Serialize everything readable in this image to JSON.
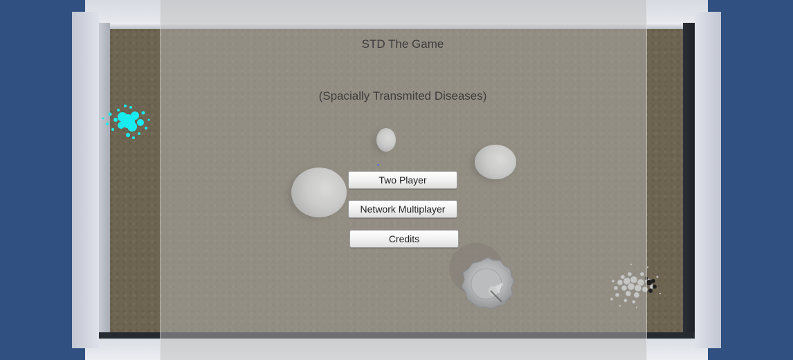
{
  "game": {
    "title": "STD The Game",
    "subtitle": "(Spacially Transmited Diseases)"
  },
  "menu": {
    "buttons": [
      {
        "label": "Two Player"
      },
      {
        "label": "Network Multiplayer"
      },
      {
        "label": "Credits"
      }
    ]
  },
  "colors": {
    "background": "#2f5080",
    "floor": "#6d6451",
    "particles_cyan": "#19ecf0",
    "particles_grey": "#c8c8c8"
  },
  "scene": {
    "objects": [
      "cyan-particle-cluster",
      "grey-particle-cluster",
      "small-sphere",
      "large-sphere",
      "medium-sphere",
      "spiked-cell"
    ]
  }
}
